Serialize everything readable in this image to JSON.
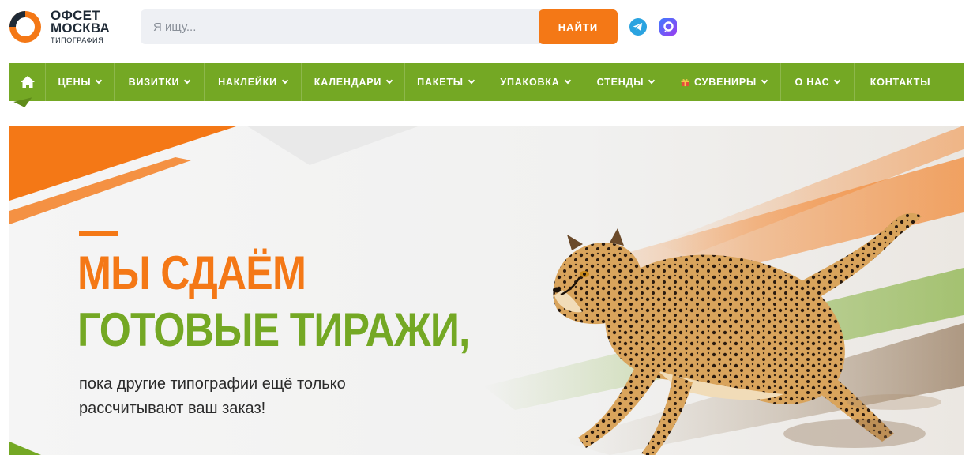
{
  "logo": {
    "line1": "ОФСЕТ",
    "line2": "МОСКВА",
    "sub": "ТИПОГРАФИЯ"
  },
  "search": {
    "placeholder": "Я ищу...",
    "button_label": "НАЙТИ"
  },
  "social": [
    "telegram-icon",
    "max-messenger-icon"
  ],
  "nav": {
    "home_icon": "home-icon",
    "items": [
      {
        "label": "ЦЕНЫ",
        "has_dropdown": true
      },
      {
        "label": "ВИЗИТКИ",
        "has_dropdown": true
      },
      {
        "label": "НАКЛЕЙКИ",
        "has_dropdown": true
      },
      {
        "label": "КАЛЕНДАРИ",
        "has_dropdown": true
      },
      {
        "label": "ПАКЕТЫ",
        "has_dropdown": true
      },
      {
        "label": "УПАКОВКА",
        "has_dropdown": true
      },
      {
        "label": "СТЕНДЫ",
        "has_dropdown": true
      },
      {
        "label": "СУВЕНИРЫ",
        "has_dropdown": true,
        "icon": "gift-icon"
      },
      {
        "label": "О НАС",
        "has_dropdown": true
      },
      {
        "label": "КОНТАКТЫ",
        "has_dropdown": false
      }
    ]
  },
  "hero": {
    "title_line1": "МЫ СДАЁМ",
    "title_line2": "ГОТОВЫЕ ТИРАЖИ,",
    "subtitle_line1": "пока другие типографии ещё только",
    "subtitle_line2": "рассчитывают ваш заказ!",
    "image": "running-cheetah-illustration"
  },
  "colors": {
    "accent_orange": "#f47816",
    "nav_green": "#74a824",
    "logo_dark": "#1f2a36",
    "search_bg": "#eef0f4",
    "telegram_blue": "#2aa3e0"
  }
}
